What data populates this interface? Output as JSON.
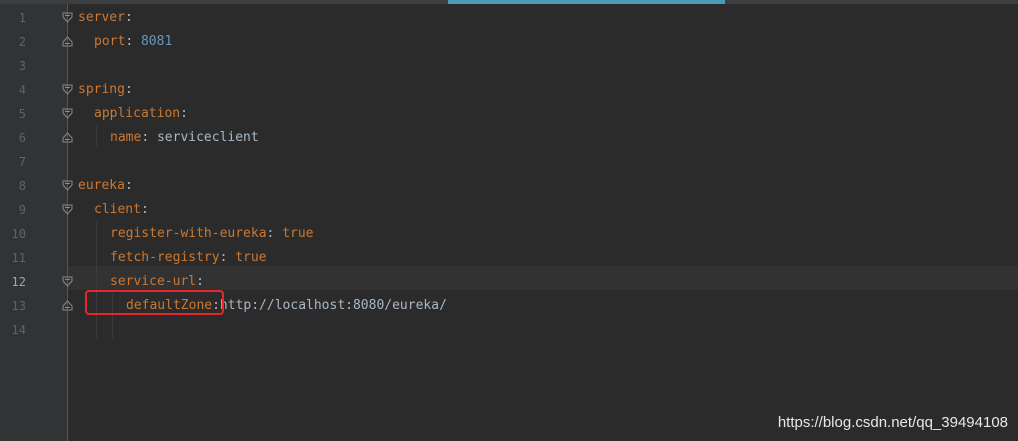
{
  "editor": {
    "line_numbers": [
      "1",
      "2",
      "3",
      "4",
      "5",
      "6",
      "7",
      "8",
      "9",
      "10",
      "11",
      "12",
      "13",
      "14"
    ],
    "current_line": "12",
    "lines": [
      {
        "key": "server",
        "sep": ":",
        "value": ""
      },
      {
        "key": "port",
        "sep": ":",
        "value": "8081"
      },
      {
        "key": "",
        "sep": "",
        "value": ""
      },
      {
        "key": "spring",
        "sep": ":",
        "value": ""
      },
      {
        "key": "application",
        "sep": ":",
        "value": ""
      },
      {
        "key": "name",
        "sep": ":",
        "value": "serviceclient"
      },
      {
        "key": "",
        "sep": "",
        "value": ""
      },
      {
        "key": "eureka",
        "sep": ":",
        "value": ""
      },
      {
        "key": "client",
        "sep": ":",
        "value": ""
      },
      {
        "key": "register-with-eureka",
        "sep": ":",
        "value": "true"
      },
      {
        "key": "fetch-registry",
        "sep": ":",
        "value": "true"
      },
      {
        "key": "service-url",
        "sep": ":",
        "value": ""
      },
      {
        "key": "defaultZone",
        "sep": ":",
        "value": "http://localhost:8080/eureka/"
      },
      {
        "key": "",
        "sep": "",
        "value": ""
      }
    ]
  },
  "watermark": "https://blog.csdn.net/qq_39494108",
  "colors": {
    "background": "#2b2b2b",
    "gutter": "#313335",
    "key": "#cc7832",
    "number": "#6897bb",
    "text": "#a9b7c6",
    "highlight_box": "#e5262a",
    "tab_indicator": "#4a9bb5"
  },
  "icons": {
    "fold_open": "fold-open-icon",
    "fold_close": "fold-close-icon"
  }
}
